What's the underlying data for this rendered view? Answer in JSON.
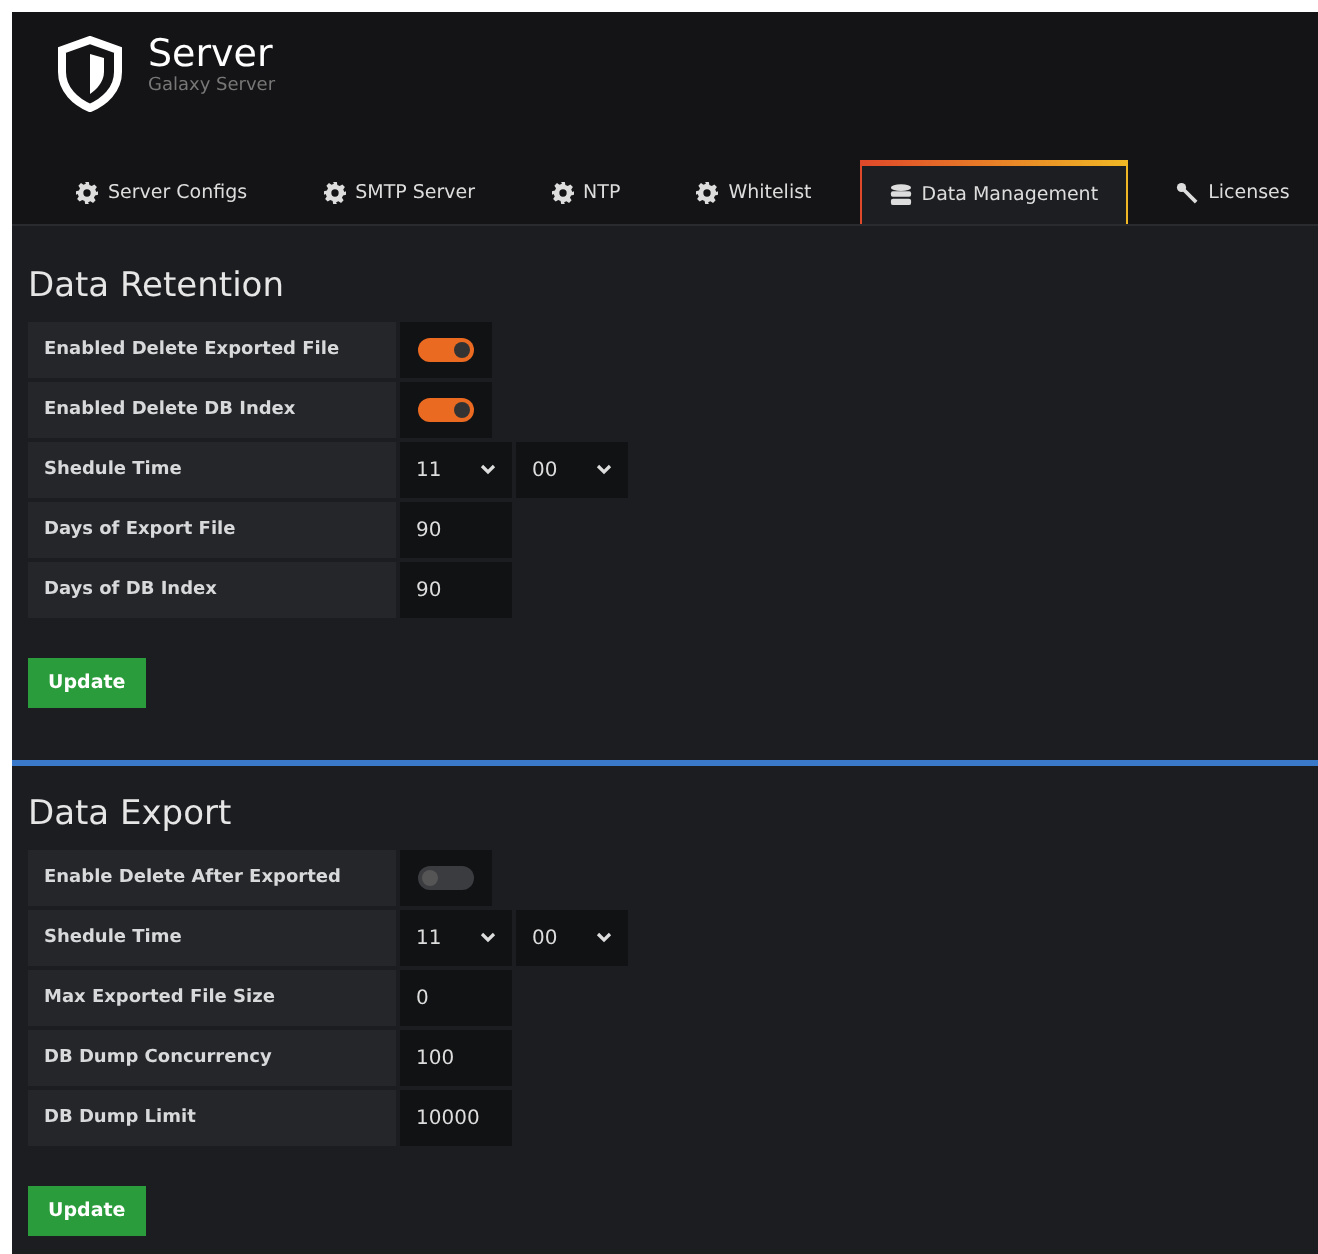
{
  "header": {
    "title": "Server",
    "subtitle": "Galaxy Server"
  },
  "tabs": [
    {
      "label": "Server Configs",
      "selected": false
    },
    {
      "label": "SMTP Server",
      "selected": false
    },
    {
      "label": "NTP",
      "selected": false
    },
    {
      "label": "Whitelist",
      "selected": false
    },
    {
      "label": "Data Management",
      "selected": true
    },
    {
      "label": "Licenses",
      "selected": false
    }
  ],
  "sections": [
    {
      "title": "Data Retention",
      "button": "Update",
      "rows": [
        {
          "label": "Enabled Delete Exported File",
          "kind": "toggle",
          "on": true
        },
        {
          "label": "Enabled Delete DB Index",
          "kind": "toggle",
          "on": true
        },
        {
          "label": "Shedule Time",
          "kind": "time",
          "hour": "11",
          "minute": "00"
        },
        {
          "label": "Days of Export File",
          "kind": "input",
          "value": "90"
        },
        {
          "label": "Days of DB Index",
          "kind": "input",
          "value": "90"
        }
      ]
    },
    {
      "title": "Data Export",
      "button": "Update",
      "rows": [
        {
          "label": "Enable Delete After Exported",
          "kind": "toggle",
          "on": false
        },
        {
          "label": "Shedule Time",
          "kind": "time",
          "hour": "11",
          "minute": "00"
        },
        {
          "label": "Max Exported File Size",
          "kind": "input",
          "value": "0"
        },
        {
          "label": "DB Dump Concurrency",
          "kind": "input",
          "value": "100"
        },
        {
          "label": "DB Dump Limit",
          "kind": "input",
          "value": "10000"
        }
      ]
    }
  ]
}
